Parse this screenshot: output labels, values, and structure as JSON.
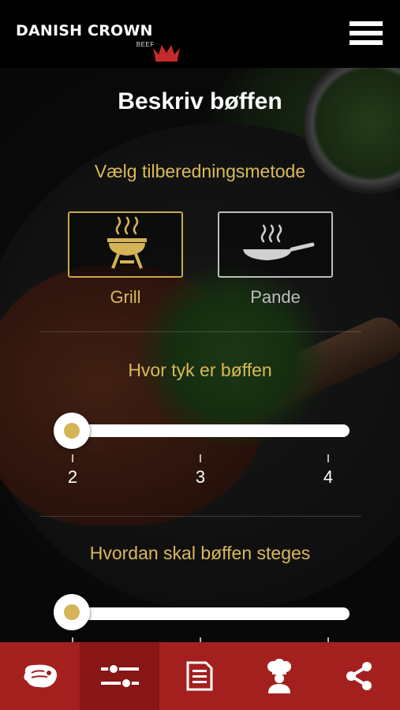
{
  "header": {
    "brand_name": "DANISH CROWN",
    "brand_sub": "BEEF",
    "logo_icon": "crown-icon",
    "menu_icon": "hamburger-icon"
  },
  "page": {
    "title": "Beskriv bøffen"
  },
  "cooking_method": {
    "label": "Vælg tilberedningsmetode",
    "options": [
      {
        "label": "Grill",
        "icon": "grill-icon",
        "selected": true
      },
      {
        "label": "Pande",
        "icon": "pan-icon",
        "selected": false
      }
    ]
  },
  "thickness": {
    "label": "Hvor tyk er bøffen",
    "ticks": [
      "2",
      "3",
      "4"
    ],
    "value": 2
  },
  "doneness": {
    "label": "Hvordan skal bøffen steges",
    "position": 0
  },
  "tabs": [
    {
      "icon": "steak-icon",
      "active": false
    },
    {
      "icon": "sliders-icon",
      "active": true
    },
    {
      "icon": "document-icon",
      "active": false
    },
    {
      "icon": "chef-icon",
      "active": false
    },
    {
      "icon": "share-icon",
      "active": false
    }
  ],
  "colors": {
    "accent_gold": "#d9b95a",
    "tabbar_red": "#a3201e",
    "tab_active": "#871614"
  }
}
